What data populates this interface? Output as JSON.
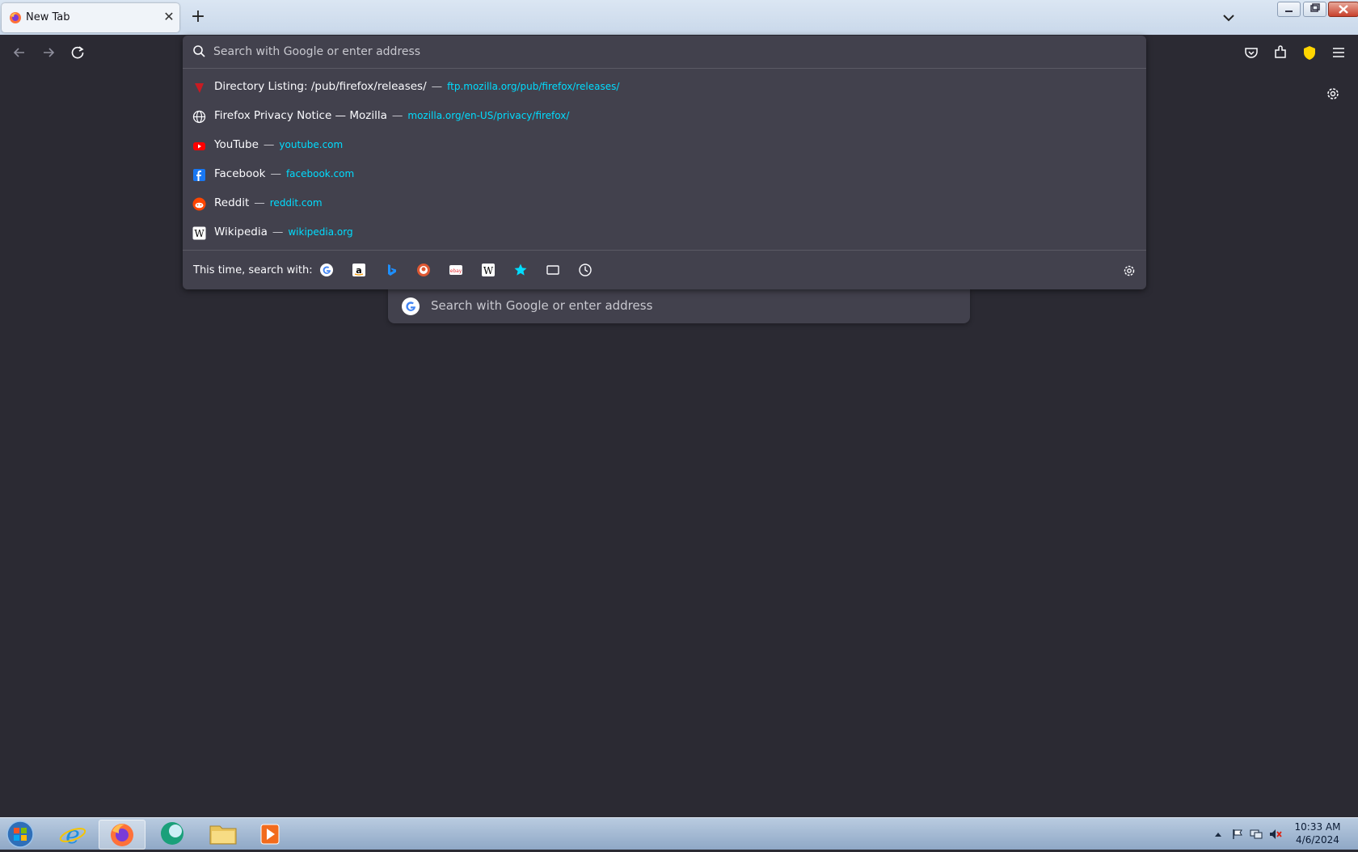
{
  "tab": {
    "title": "New Tab",
    "close": "✕"
  },
  "toolbar": {
    "new_tab": "+"
  },
  "urlbar": {
    "placeholder": "Search with Google or enter address",
    "results": [
      {
        "title": "Directory Listing: /pub/firefox/releases/",
        "url": "ftp.mozilla.org/pub/firefox/releases/",
        "icon": "ftp-icon",
        "sep": "—"
      },
      {
        "title": "Firefox Privacy Notice — Mozilla",
        "url": "mozilla.org/en-US/privacy/firefox/",
        "icon": "globe-icon",
        "sep": "—"
      },
      {
        "title": "YouTube",
        "url": "youtube.com",
        "icon": "youtube-icon",
        "sep": "—"
      },
      {
        "title": "Facebook",
        "url": "facebook.com",
        "icon": "facebook-icon",
        "sep": "—"
      },
      {
        "title": "Reddit",
        "url": "reddit.com",
        "icon": "reddit-icon",
        "sep": "—"
      },
      {
        "title": "Wikipedia",
        "url": "wikipedia.org",
        "icon": "wikipedia-icon",
        "sep": "—"
      }
    ],
    "search_with_label": "This time, search with:",
    "engines": [
      "google-icon",
      "amazon-icon",
      "bing-icon",
      "duckduckgo-icon",
      "ebay-icon",
      "wikipedia-icon",
      "bookmarks-icon",
      "tabs-icon",
      "history-icon"
    ]
  },
  "content": {
    "search_placeholder": "Search with Google or enter address"
  },
  "taskbar": {
    "time": "10:33 AM",
    "date": "4/6/2024"
  },
  "colors": {
    "bg": "#2b2a33",
    "panel": "#42414d",
    "url": "#00ddff"
  }
}
